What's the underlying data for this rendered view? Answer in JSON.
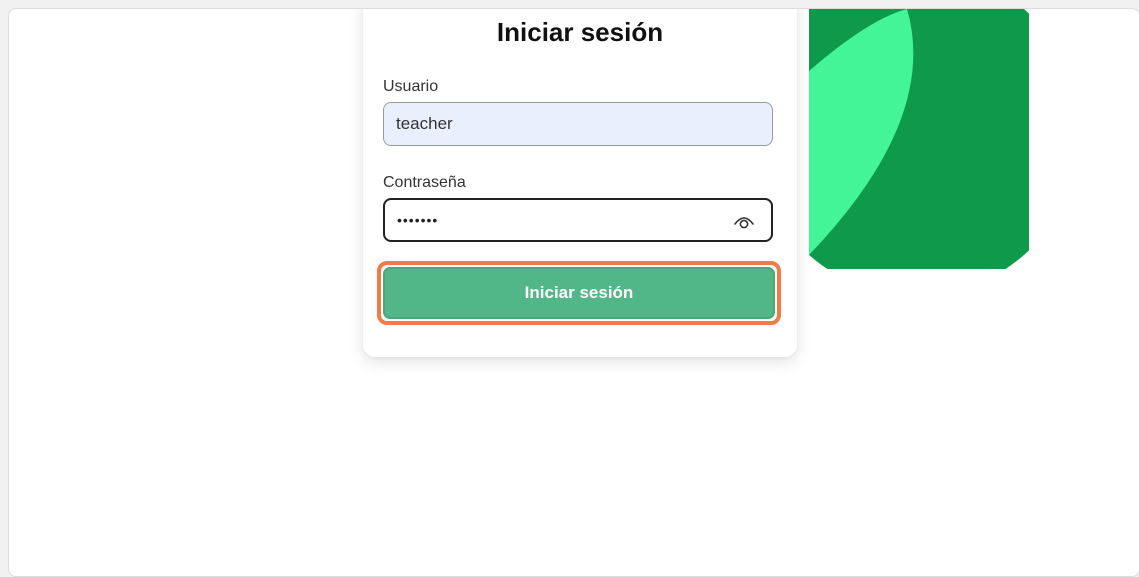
{
  "login": {
    "title": "Iniciar sesión",
    "username_label": "Usuario",
    "username_value": "teacher",
    "password_label": "Contraseña",
    "password_value": "•••••••",
    "submit_label": "Iniciar sesión"
  },
  "icons": {
    "password_toggle": "eye-icon"
  },
  "colors": {
    "button_green": "#52b788",
    "focus_outline": "#f07b44",
    "decor_dark_green": "#0e9a4a",
    "decor_light_green": "#44f597",
    "username_field_bg": "#e8f0fe"
  }
}
